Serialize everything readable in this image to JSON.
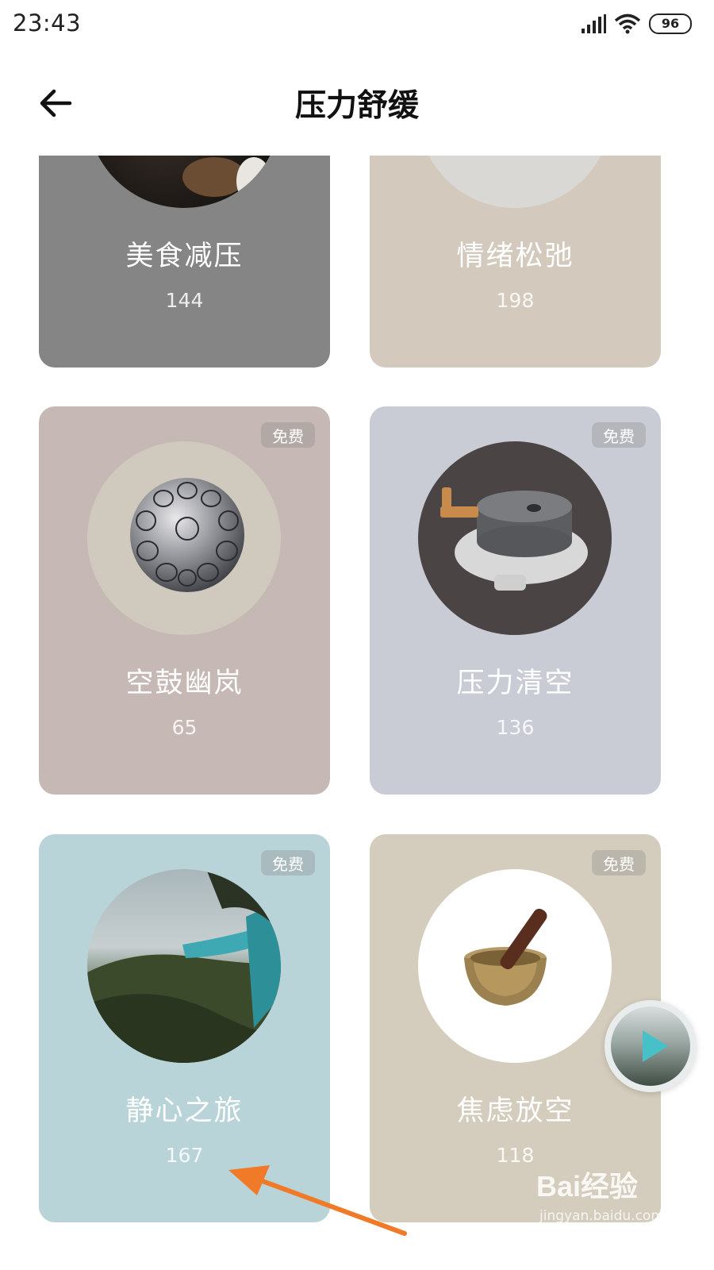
{
  "status_bar": {
    "time": "23:43",
    "battery": "96",
    "icons": [
      "signal-icon",
      "wifi-icon",
      "battery-icon"
    ]
  },
  "header": {
    "title": "压力舒缓",
    "back_icon": "back-arrow-icon"
  },
  "cards": [
    {
      "title": "美食减压",
      "count": "144",
      "badge": "",
      "bg": "#858585"
    },
    {
      "title": "情绪松弛",
      "count": "198",
      "badge": "",
      "bg": "#d3cabd"
    },
    {
      "title": "空鼓幽岚",
      "count": "65",
      "badge": "免费",
      "bg": "#c6b8b4"
    },
    {
      "title": "压力清空",
      "count": "136",
      "badge": "免费",
      "bg": "#c9ccd4"
    },
    {
      "title": "静心之旅",
      "count": "167",
      "badge": "免费",
      "bg": "#b9d4d9"
    },
    {
      "title": "焦虑放空",
      "count": "118",
      "badge": "免费",
      "bg": "#d4ccbc"
    }
  ],
  "floating_player": {
    "icon": "play-icon"
  },
  "watermark": {
    "logo": "Bai经验",
    "url": "jingyan.baidu.com"
  }
}
